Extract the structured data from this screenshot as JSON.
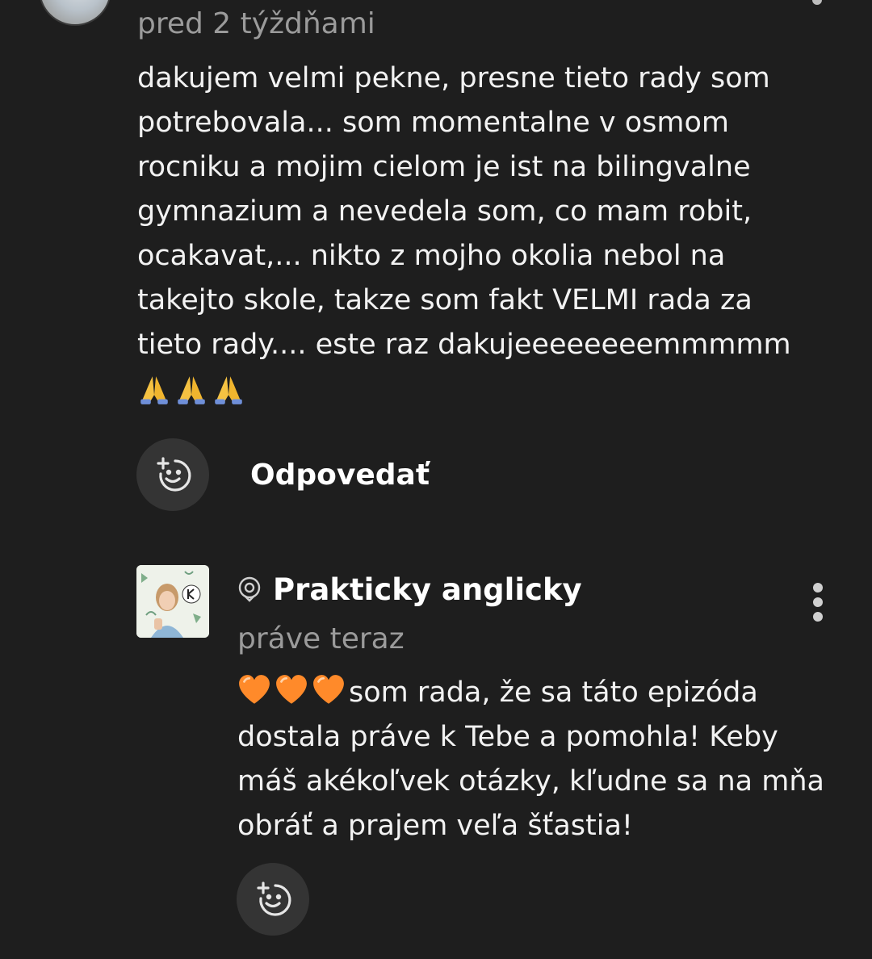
{
  "comments": [
    {
      "avatar": "user-avatar",
      "timestamp": "pred 2 týždňami",
      "lines": [
        "dakujem velmi pekne, presne tieto rady som",
        "potrebovala... som momentalne v osmom",
        "rocniku a mojim cielom je ist na bilingvalne",
        "gymnazium a nevedela som, co mam robit,",
        "ocakavat,... nikto z mojho okolia nebol na",
        "takejto skole, takze som fakt VELMI rada za",
        "tieto rady.... este raz dakujeeeeeeeemmmmm"
      ],
      "emoji": [
        "🙏",
        "🙏",
        "🙏"
      ],
      "reply_label": "Odpovedať",
      "react_icon": "add-reaction-icon"
    },
    {
      "author": "Prakticky anglicky",
      "author_badge_icon": "creator-badge-icon",
      "avatar": "podcast-cover-avatar",
      "timestamp": "práve teraz",
      "lead_emoji": [
        "🧡",
        "🧡",
        "🧡"
      ],
      "lines": [
        "som rada, že sa táto epizóda",
        "dostala práve k Tebe a pomohla! Keby",
        "máš akékoľvek otázky, kľudne sa na mňa",
        "obráť a prajem veľa šťastia!"
      ],
      "react_icon": "add-reaction-icon",
      "menu_icon": "more-vertical-icon"
    }
  ],
  "colors": {
    "background": "#1e1e1e",
    "text": "#f2f2f2",
    "muted": "#9b9b9b",
    "button_bg": "#343434",
    "heart": "#ff8a2a"
  }
}
